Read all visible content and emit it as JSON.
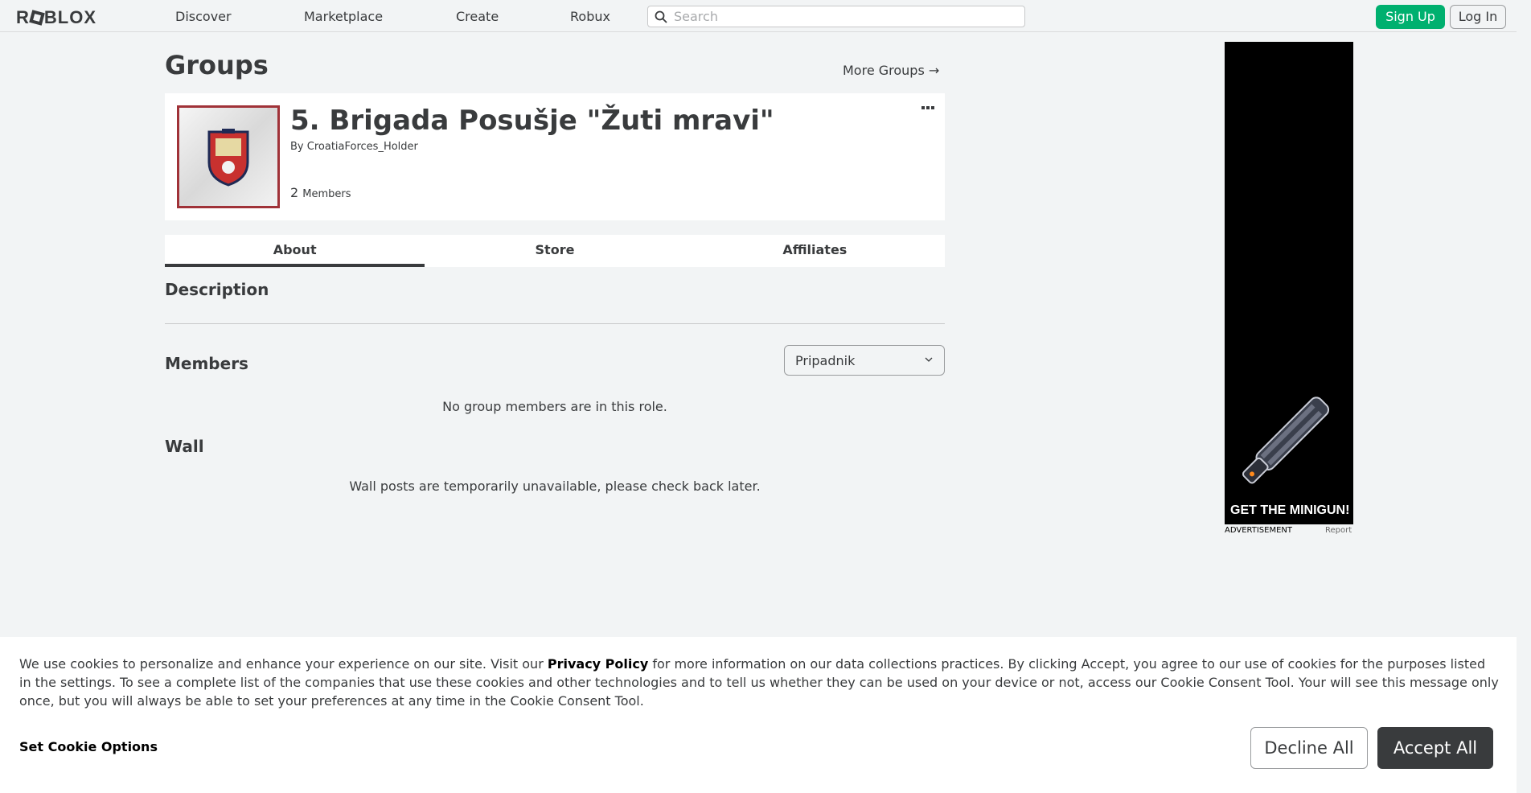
{
  "nav": {
    "logo": "ROBLOX",
    "links": [
      "Discover",
      "Marketplace",
      "Create",
      "Robux"
    ],
    "search_placeholder": "Search",
    "signup": "Sign Up",
    "login": "Log In"
  },
  "page": {
    "title": "Groups",
    "more_groups": "More Groups →"
  },
  "group": {
    "name": "5. Brigada Posušje \"Žuti mravi\"",
    "by_label": "By",
    "owner": "CroatiaForces_Holder",
    "member_count": "2",
    "members_label": "Members"
  },
  "tabs": [
    "About",
    "Store",
    "Affiliates"
  ],
  "sections": {
    "description": "Description",
    "members": "Members",
    "role_selected": "Pripadnik",
    "no_members": "No group members are in this role.",
    "wall": "Wall",
    "wall_unavailable": "Wall posts are temporarily unavailable, please check back later."
  },
  "ad": {
    "caption": "GET THE MINIGUN!",
    "label": "ADVERTISEMENT",
    "report": "Report"
  },
  "cookie": {
    "text_before": "We use cookies to personalize and enhance your experience on our site. Visit our ",
    "privacy_link": "Privacy Policy",
    "text_after": " for more information on our data collections practices. By clicking Accept, you agree to our use of cookies for the purposes listed in the settings. To see a complete list of the companies that use these cookies and other technologies and to tell us whether they can be used on your device or not, access our Cookie Consent Tool. Your will see this message only once, but you will always be able to set your preferences at any time in the Cookie Consent Tool.",
    "set_options": "Set Cookie Options",
    "decline": "Decline All",
    "accept": "Accept All"
  },
  "colors": {
    "signup_green": "#00b06f",
    "text_dark": "#393b3d",
    "emblem_border": "#a03238",
    "accept_bg": "#393b3d"
  }
}
